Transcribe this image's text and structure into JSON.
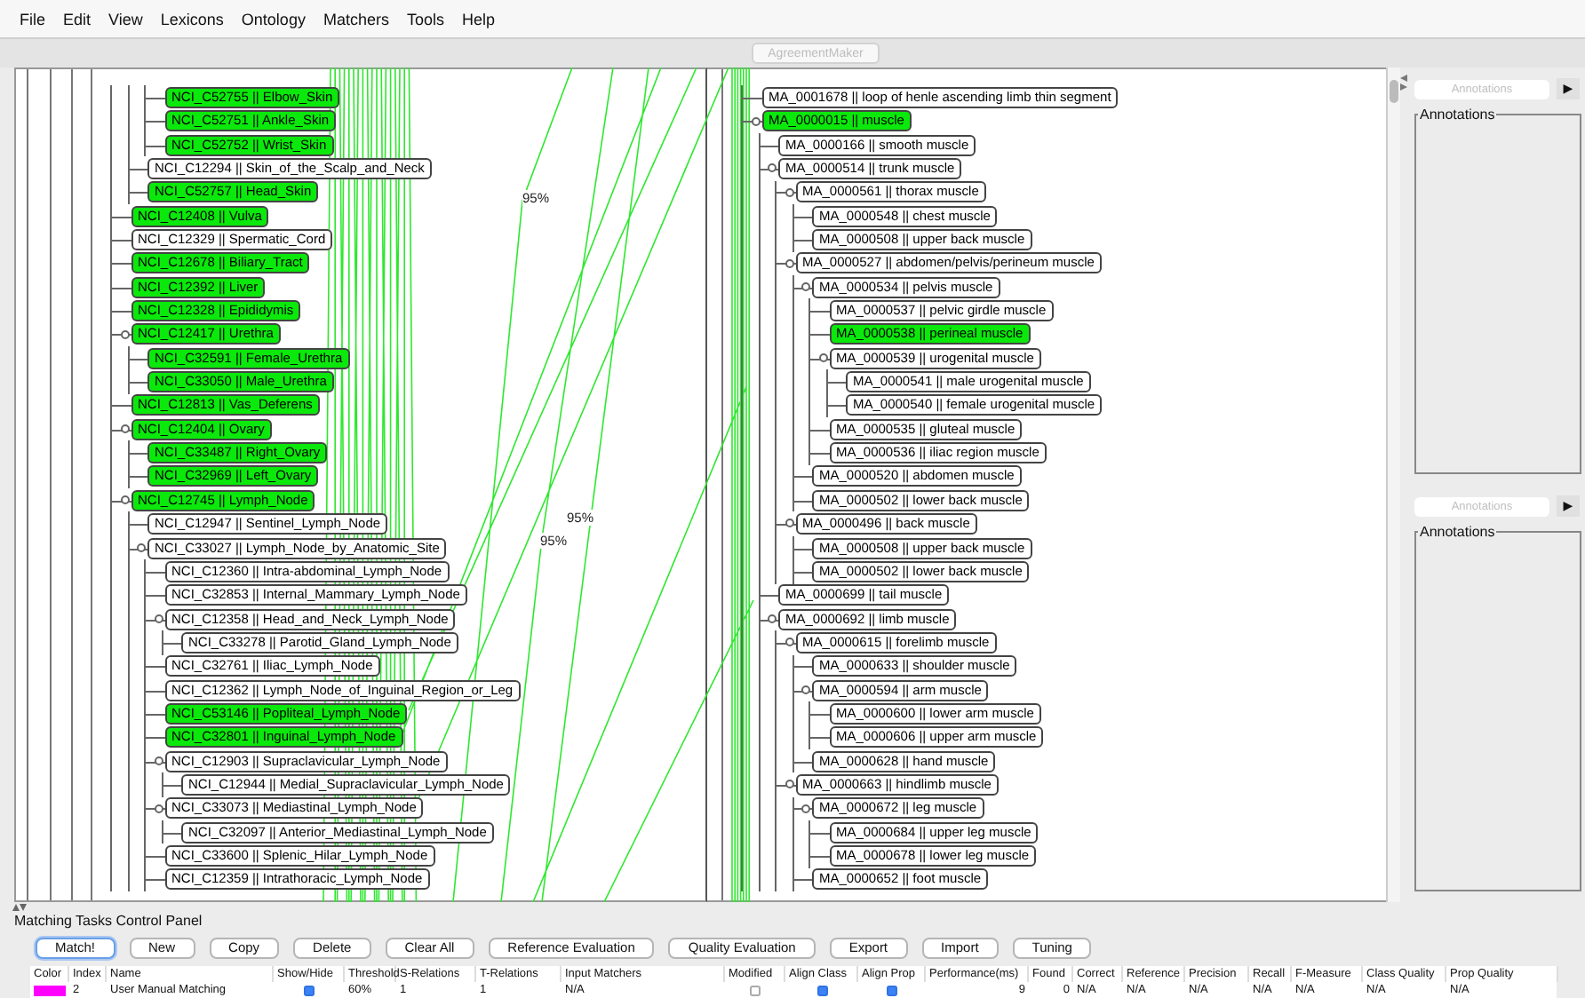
{
  "menu": [
    "File",
    "Edit",
    "View",
    "Lexicons",
    "Ontology",
    "Matchers",
    "Tools",
    "Help"
  ],
  "toolbar": {
    "title_button": "AgreementMaker",
    "disabled": true
  },
  "left_tree": {
    "nodes": [
      {
        "children": [
          {
            "children": [
              {
                "label": "NCI_C52755 || Elbow_Skin",
                "matched": true,
                "expanded": false
              },
              {
                "label": "NCI_C52751 || Ankle_Skin",
                "matched": true,
                "expanded": false
              },
              {
                "label": "NCI_C52752 || Wrist_Skin",
                "matched": true,
                "expanded": false
              }
            ]
          },
          {
            "label": "NCI_C12294 || Skin_of_the_Scalp_and_Neck",
            "matched": false,
            "expanded": false
          },
          {
            "label": "NCI_C52757 || Head_Skin",
            "matched": true,
            "expanded": false
          }
        ]
      },
      {
        "label": "NCI_C12408 || Vulva",
        "matched": true,
        "expanded": false
      },
      {
        "label": "NCI_C12329 || Spermatic_Cord",
        "matched": false,
        "expanded": false
      },
      {
        "label": "NCI_C12678 || Biliary_Tract",
        "matched": true,
        "expanded": false
      },
      {
        "label": "NCI_C12392 || Liver",
        "matched": true,
        "expanded": false
      },
      {
        "label": "NCI_C12328 || Epididymis",
        "matched": true,
        "expanded": false
      },
      {
        "label": "NCI_C12417 || Urethra",
        "matched": true,
        "expanded": true,
        "children": [
          {
            "label": "NCI_C32591 || Female_Urethra",
            "matched": true,
            "expanded": false
          },
          {
            "label": "NCI_C33050 || Male_Urethra",
            "matched": true,
            "expanded": false
          }
        ]
      },
      {
        "label": "NCI_C12813 || Vas_Deferens",
        "matched": true,
        "expanded": false
      },
      {
        "label": "NCI_C12404 || Ovary",
        "matched": true,
        "expanded": true,
        "children": [
          {
            "label": "NCI_C33487 || Right_Ovary",
            "matched": true,
            "expanded": false
          },
          {
            "label": "NCI_C32969 || Left_Ovary",
            "matched": true,
            "expanded": false
          }
        ]
      },
      {
        "label": "NCI_C12745 || Lymph_Node",
        "matched": true,
        "expanded": true,
        "children": [
          {
            "label": "NCI_C12947 || Sentinel_Lymph_Node",
            "matched": false,
            "expanded": false
          },
          {
            "label": "NCI_C33027 || Lymph_Node_by_Anatomic_Site",
            "matched": false,
            "expanded": true,
            "children": [
              {
                "label": "NCI_C12360 || Intra-abdominal_Lymph_Node",
                "matched": false,
                "expanded": false
              },
              {
                "label": "NCI_C32853 || Internal_Mammary_Lymph_Node",
                "matched": false,
                "expanded": false
              },
              {
                "label": "NCI_C12358 || Head_and_Neck_Lymph_Node",
                "matched": false,
                "expanded": true,
                "children": [
                  {
                    "label": "NCI_C33278 || Parotid_Gland_Lymph_Node",
                    "matched": false,
                    "expanded": false
                  }
                ]
              },
              {
                "label": "NCI_C32761 || Iliac_Lymph_Node",
                "matched": false,
                "expanded": false
              },
              {
                "label": "NCI_C12362 || Lymph_Node_of_Inguinal_Region_or_Leg",
                "matched": false,
                "expanded": false
              },
              {
                "label": "NCI_C53146 || Popliteal_Lymph_Node",
                "matched": true,
                "expanded": false
              },
              {
                "label": "NCI_C32801 || Inguinal_Lymph_Node",
                "matched": true,
                "expanded": false
              },
              {
                "label": "NCI_C12903 || Supraclavicular_Lymph_Node",
                "matched": false,
                "expanded": true,
                "children": [
                  {
                    "label": "NCI_C12944 || Medial_Supraclavicular_Lymph_Node",
                    "matched": false,
                    "expanded": false
                  }
                ]
              },
              {
                "label": "NCI_C33073 || Mediastinal_Lymph_Node",
                "matched": false,
                "expanded": true,
                "children": [
                  {
                    "label": "NCI_C32097 || Anterior_Mediastinal_Lymph_Node",
                    "matched": false,
                    "expanded": false
                  }
                ]
              },
              {
                "label": "NCI_C33600 || Splenic_Hilar_Lymph_Node",
                "matched": false,
                "expanded": false
              },
              {
                "label": "NCI_C12359 || Intrathoracic_Lymph_Node",
                "matched": false,
                "expanded": false
              }
            ]
          }
        ]
      }
    ]
  },
  "right_tree": {
    "nodes": [
      {
        "label": "MA_0001678 || loop of henle ascending limb thin segment",
        "matched": false,
        "expanded": false
      },
      {
        "label": "MA_0000015 || muscle",
        "matched": true,
        "expanded": true,
        "children": [
          {
            "label": "MA_0000166 || smooth muscle",
            "matched": false,
            "expanded": false
          },
          {
            "label": "MA_0000514 || trunk muscle",
            "matched": false,
            "expanded": true,
            "children": [
              {
                "label": "MA_0000561 || thorax muscle",
                "matched": false,
                "expanded": true,
                "children": [
                  {
                    "label": "MA_0000548 || chest muscle",
                    "matched": false,
                    "expanded": false
                  },
                  {
                    "label": "MA_0000508 || upper back muscle",
                    "matched": false,
                    "expanded": false
                  }
                ]
              },
              {
                "label": "MA_0000527 || abdomen/pelvis/perineum muscle",
                "matched": false,
                "expanded": true,
                "children": [
                  {
                    "label": "MA_0000534 || pelvis muscle",
                    "matched": false,
                    "expanded": true,
                    "children": [
                      {
                        "label": "MA_0000537 || pelvic girdle muscle",
                        "matched": false,
                        "expanded": false
                      },
                      {
                        "label": "MA_0000538 || perineal muscle",
                        "matched": true,
                        "expanded": false
                      },
                      {
                        "label": "MA_0000539 || urogenital muscle",
                        "matched": false,
                        "expanded": true,
                        "children": [
                          {
                            "label": "MA_0000541 || male urogenital muscle",
                            "matched": false,
                            "expanded": false
                          },
                          {
                            "label": "MA_0000540 || female urogenital muscle",
                            "matched": false,
                            "expanded": false
                          }
                        ]
                      },
                      {
                        "label": "MA_0000535 || gluteal muscle",
                        "matched": false,
                        "expanded": false
                      },
                      {
                        "label": "MA_0000536 || iliac region muscle",
                        "matched": false,
                        "expanded": false
                      }
                    ]
                  },
                  {
                    "label": "MA_0000520 || abdomen muscle",
                    "matched": false,
                    "expanded": false
                  },
                  {
                    "label": "MA_0000502 || lower back muscle",
                    "matched": false,
                    "expanded": false
                  }
                ]
              },
              {
                "label": "MA_0000496 || back muscle",
                "matched": false,
                "expanded": true,
                "children": [
                  {
                    "label": "MA_0000508 || upper back muscle",
                    "matched": false,
                    "expanded": false
                  },
                  {
                    "label": "MA_0000502 || lower back muscle",
                    "matched": false,
                    "expanded": false
                  }
                ]
              }
            ]
          },
          {
            "label": "MA_0000699 || tail muscle",
            "matched": false,
            "expanded": false
          },
          {
            "label": "MA_0000692 || limb muscle",
            "matched": false,
            "expanded": true,
            "children": [
              {
                "label": "MA_0000615 || forelimb muscle",
                "matched": false,
                "expanded": true,
                "children": [
                  {
                    "label": "MA_0000633 || shoulder muscle",
                    "matched": false,
                    "expanded": false
                  },
                  {
                    "label": "MA_0000594 || arm muscle",
                    "matched": false,
                    "expanded": true,
                    "children": [
                      {
                        "label": "MA_0000600 || lower arm muscle",
                        "matched": false,
                        "expanded": false
                      },
                      {
                        "label": "MA_0000606 || upper arm muscle",
                        "matched": false,
                        "expanded": false
                      }
                    ]
                  },
                  {
                    "label": "MA_0000628 || hand muscle",
                    "matched": false,
                    "expanded": false
                  }
                ]
              },
              {
                "label": "MA_0000663 || hindlimb muscle",
                "matched": false,
                "expanded": true,
                "children": [
                  {
                    "label": "MA_0000672 || leg muscle",
                    "matched": false,
                    "expanded": true,
                    "children": [
                      {
                        "label": "MA_0000684 || upper leg muscle",
                        "matched": false,
                        "expanded": false
                      },
                      {
                        "label": "MA_0000678 || lower leg muscle",
                        "matched": false,
                        "expanded": false
                      }
                    ]
                  },
                  {
                    "label": "MA_0000652 || foot muscle",
                    "matched": false,
                    "expanded": false
                  }
                ]
              }
            ]
          }
        ]
      }
    ]
  },
  "mappings": [
    {
      "label": "95%"
    },
    {
      "label": "95%"
    },
    {
      "label": "95%"
    }
  ],
  "sidebar": {
    "panels": [
      {
        "selector": "Annotations",
        "button": "▶",
        "group": "Annotations"
      },
      {
        "selector": "Annotations",
        "button": "▶",
        "group": "Annotations"
      }
    ]
  },
  "control_panel": {
    "title": "Matching Tasks Control Panel",
    "buttons": [
      {
        "label": "Match!",
        "focused": true
      },
      {
        "label": "New",
        "focused": false
      },
      {
        "label": "Copy",
        "focused": false
      },
      {
        "label": "Delete",
        "focused": false
      },
      {
        "label": "Clear All",
        "focused": false
      },
      {
        "label": "Reference Evaluation",
        "focused": false
      },
      {
        "label": "Quality Evaluation",
        "focused": false
      },
      {
        "label": "Export",
        "focused": false
      },
      {
        "label": "Import",
        "focused": false
      },
      {
        "label": "Tuning",
        "focused": false
      }
    ],
    "table": {
      "columns": [
        "Color",
        "Index",
        "Name",
        "Show/Hide",
        "Threshold",
        "S-Relations",
        "T-Relations",
        "Input Matchers",
        "Modified",
        "Align Class",
        "Align Prop",
        "Performance(ms)",
        "Found",
        "Correct",
        "Reference",
        "Precision",
        "Recall",
        "F-Measure",
        "Class Quality",
        "Prop Quality"
      ],
      "rows": [
        {
          "color": "#ff00ff",
          "index": "2",
          "name": "User Manual Matching",
          "show": true,
          "threshold": "60%",
          "s_relations": "1",
          "t_relations": "1",
          "input_matchers": "N/A",
          "modified": false,
          "align_class": true,
          "align_prop": true,
          "performance": "9",
          "found": "0",
          "correct": "N/A",
          "reference": "N/A",
          "precision": "N/A",
          "recall": "N/A",
          "f_measure": "N/A",
          "class_quality": "N/A",
          "prop_quality": "N/A"
        }
      ]
    }
  }
}
